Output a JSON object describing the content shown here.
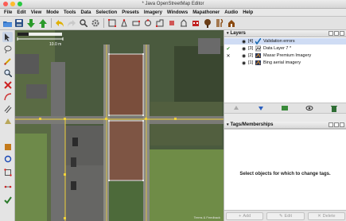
{
  "window": {
    "title": "* Java OpenStreetMap Editor",
    "traffic_lights": [
      "#fc5d55",
      "#fdbb2d",
      "#27c840"
    ]
  },
  "menu": [
    "File",
    "Edit",
    "View",
    "Mode",
    "Tools",
    "Data",
    "Selection",
    "Presets",
    "Imagery",
    "Windows",
    "Mapathoner",
    "Audio",
    "Help"
  ],
  "toolbar_icons": [
    "open-folder-icon",
    "save-icon",
    "download-icon",
    "upload-icon",
    "undo-icon",
    "redo-icon",
    "zoom-icon",
    "preferences-icon",
    "mapathoner-a-icon",
    "mapathoner-b-icon",
    "mapathoner-c-icon",
    "mapathoner-d-icon",
    "mapathoner-e-icon",
    "mapathoner-f-icon",
    "mapathoner-g-icon",
    "building-icon",
    "tree-icon",
    "cutlery-icon",
    "house-icon"
  ],
  "left_tools": [
    "select-icon",
    "lasso-icon",
    "draw-icon",
    "zoom-icon",
    "delete-icon",
    "improve-way-icon",
    "parallel-icon",
    "building-tool-icon",
    "align-icon",
    "circle-icon",
    "orthogonal-icon",
    "split-icon",
    "validate-icon"
  ],
  "map": {
    "scale_label": "10.0 m",
    "attribution": "Terms & Feedback"
  },
  "layers_panel": {
    "title": "Layers",
    "layers": [
      {
        "num": "[4]",
        "name": "Validation errors",
        "active": true,
        "icon": "validation-icon"
      },
      {
        "num": "[3]",
        "name": "Data Layer 7 *",
        "active": false,
        "icon": "data-layer-icon"
      },
      {
        "num": "[2]",
        "name": "Maxar Premium Imagery",
        "active": false,
        "icon": "maxar-icon"
      },
      {
        "num": "[1]",
        "name": "Bing aerial imagery",
        "active": false,
        "icon": "bing-icon"
      }
    ],
    "buttons": [
      "move-up-icon",
      "move-down-icon",
      "merge-icon",
      "visibility-icon",
      "delete-icon"
    ]
  },
  "tags_panel": {
    "title": "Tags/Memberships",
    "empty_message": "Select objects for which to change tags.",
    "buttons": [
      {
        "label": "Add",
        "symbol": "+"
      },
      {
        "label": "Edit",
        "symbol": "✎"
      },
      {
        "label": "Delete",
        "symbol": "✕"
      }
    ]
  }
}
